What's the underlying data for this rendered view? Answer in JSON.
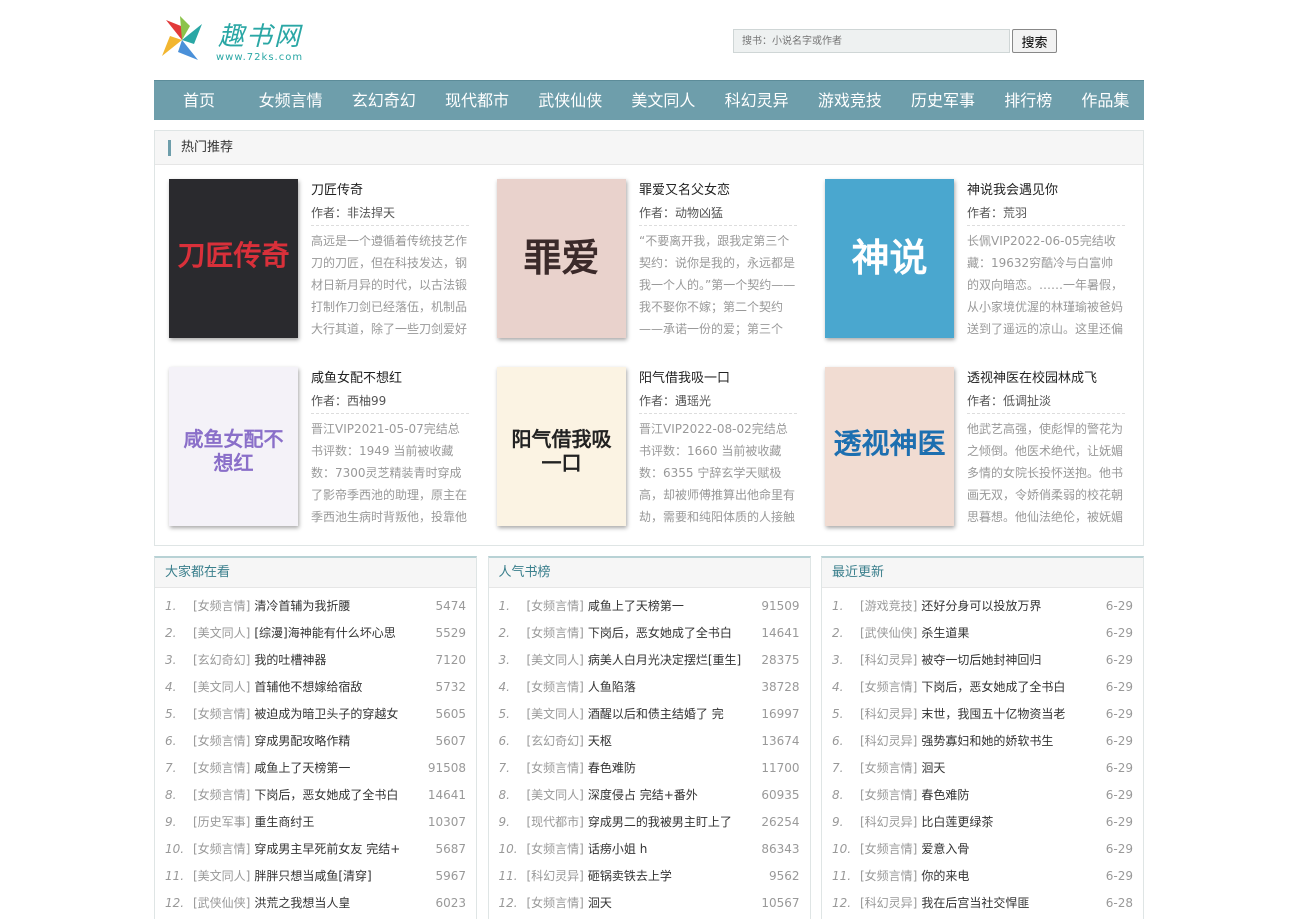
{
  "header": {
    "logo_text": "趣书网",
    "logo_url": "www.72ks.com",
    "search_placeholder": "搜书：小说名字或作者",
    "search_button": "搜索"
  },
  "nav": [
    "首页",
    "女频言情",
    "玄幻奇幻",
    "现代都市",
    "武侠仙侠",
    "美文同人",
    "科幻灵异",
    "游戏竞技",
    "历史军事",
    "排行榜",
    "作品集"
  ],
  "hot": {
    "title": "热门推荐",
    "books": [
      {
        "title": "刀匠传奇",
        "author": "作者：非法捍天",
        "desc": "高远是一个遵循着传统技艺作刀的刀匠，但在科技发达，钢材日新月异的时代，以古法锻打制作刀剑已经落伍，机制品大行其道，除了一些刀剑爱好",
        "cover_text": "刀匠传奇",
        "cover_bg": "#2a2a2e",
        "cover_fg": "#d9303a"
      },
      {
        "title": "罪爱又名父女恋",
        "author": "作者：动物凶猛",
        "desc": "“不要离开我，跟我定第三个契约：说你是我的，永远都是我一个人的。”第一个契约——我不娶你不嫁；第二个契约——承诺一份的爱；第三个",
        "cover_text": "罪爱",
        "cover_bg": "#e9d2cc",
        "cover_fg": "#3b2a2a"
      },
      {
        "title": "神说我会遇见你",
        "author": "作者：荒羽",
        "desc": "长佩VIP2022-06-05完结收藏：19632穷酷冷与白富帅的双向暗恋。……一年暑假，从小家境优渥的林瑾瑜被爸妈送到了遥远的凉山。这里还偏僻",
        "cover_text": "神说",
        "cover_bg": "#4aa7cf",
        "cover_fg": "#ffffff"
      },
      {
        "title": "咸鱼女配不想红",
        "author": "作者：西柚99",
        "desc": "晋江VIP2021-05-07完结总书评数：1949 当前被收藏数：7300灵芝精装青时穿成了影帝季西池的助理，原主在季西池生病时背叛他，投靠他",
        "cover_text": "咸鱼女配不想红",
        "cover_bg": "#f4f2f8",
        "cover_fg": "#8a6fc9"
      },
      {
        "title": "阳气借我吸一口",
        "author": "作者：遇瑶光",
        "desc": "晋江VIP2022-08-02完结总书评数：1660 当前被收藏数：6355 宁辞玄学天赋极高，却被师傅推算出他命里有劫，需要和纯阳体质的人接触",
        "cover_text": "阳气借我吸一口",
        "cover_bg": "#fbf3e3",
        "cover_fg": "#222222"
      },
      {
        "title": "透视神医在校园林成飞",
        "author": "作者：低调扯淡",
        "desc": "他武艺高强，使彪悍的警花为之倾倒。他医术绝代，让妩媚多情的女院长投怀送抱。他书画无双，令娇俏柔弱的校花朝思暮想。他仙法绝伦，被妩媚",
        "cover_text": "透视神医",
        "cover_bg": "#f1dcd2",
        "cover_fg": "#1d6fb0"
      }
    ]
  },
  "lists": [
    {
      "title": "大家都在看",
      "rows": [
        {
          "n": "1.",
          "cat": "[女频言情]",
          "title": "清冷首辅为我折腰",
          "val": "5474"
        },
        {
          "n": "2.",
          "cat": "[美文同人]",
          "title": "[综漫]海神能有什么坏心思",
          "val": "5529"
        },
        {
          "n": "3.",
          "cat": "[玄幻奇幻]",
          "title": "我的吐槽神器",
          "val": "7120"
        },
        {
          "n": "4.",
          "cat": "[美文同人]",
          "title": "首辅他不想嫁给宿敌",
          "val": "5732"
        },
        {
          "n": "5.",
          "cat": "[女频言情]",
          "title": "被迫成为暗卫头子的穿越女",
          "val": "5605"
        },
        {
          "n": "6.",
          "cat": "[女频言情]",
          "title": "穿成男配攻略作精",
          "val": "5607"
        },
        {
          "n": "7.",
          "cat": "[女频言情]",
          "title": "咸鱼上了天榜第一",
          "val": "91508"
        },
        {
          "n": "8.",
          "cat": "[女频言情]",
          "title": "下岗后，恶女她成了全书白",
          "val": "14641"
        },
        {
          "n": "9.",
          "cat": "[历史军事]",
          "title": "重生商纣王",
          "val": "10307"
        },
        {
          "n": "10.",
          "cat": "[女频言情]",
          "title": "穿成男主早死前女友 完结+",
          "val": "5687"
        },
        {
          "n": "11.",
          "cat": "[美文同人]",
          "title": "胖胖只想当咸鱼[清穿]",
          "val": "5967"
        },
        {
          "n": "12.",
          "cat": "[武侠仙侠]",
          "title": "洪荒之我想当人皇",
          "val": "6023"
        }
      ]
    },
    {
      "title": "人气书榜",
      "rows": [
        {
          "n": "1.",
          "cat": "[女频言情]",
          "title": "咸鱼上了天榜第一",
          "val": "91509"
        },
        {
          "n": "2.",
          "cat": "[女频言情]",
          "title": "下岗后，恶女她成了全书白",
          "val": "14641"
        },
        {
          "n": "3.",
          "cat": "[美文同人]",
          "title": "病美人白月光决定摆烂[重生]",
          "val": "28375"
        },
        {
          "n": "4.",
          "cat": "[女频言情]",
          "title": "人鱼陷落",
          "val": "38728"
        },
        {
          "n": "5.",
          "cat": "[美文同人]",
          "title": "酒醒以后和债主结婚了 完",
          "val": "16997"
        },
        {
          "n": "6.",
          "cat": "[玄幻奇幻]",
          "title": "天枢",
          "val": "13674"
        },
        {
          "n": "7.",
          "cat": "[女频言情]",
          "title": "春色难防",
          "val": "11700"
        },
        {
          "n": "8.",
          "cat": "[美文同人]",
          "title": "深度侵占 完结+番外",
          "val": "60935"
        },
        {
          "n": "9.",
          "cat": "[现代都市]",
          "title": "穿成男二的我被男主盯上了",
          "val": "26254"
        },
        {
          "n": "10.",
          "cat": "[女频言情]",
          "title": "话痨小姐 h",
          "val": "86343"
        },
        {
          "n": "11.",
          "cat": "[科幻灵异]",
          "title": "砸锅卖铁去上学",
          "val": "9562"
        },
        {
          "n": "12.",
          "cat": "[女频言情]",
          "title": "洄天",
          "val": "10567"
        }
      ]
    },
    {
      "title": "最近更新",
      "rows": [
        {
          "n": "1.",
          "cat": "[游戏竞技]",
          "title": "还好分身可以投放万界",
          "val": "6-29"
        },
        {
          "n": "2.",
          "cat": "[武侠仙侠]",
          "title": "杀生道果",
          "val": "6-29"
        },
        {
          "n": "3.",
          "cat": "[科幻灵异]",
          "title": "被夺一切后她封神回归",
          "val": "6-29"
        },
        {
          "n": "4.",
          "cat": "[女频言情]",
          "title": "下岗后，恶女她成了全书白",
          "val": "6-29"
        },
        {
          "n": "5.",
          "cat": "[科幻灵异]",
          "title": "末世，我囤五十亿物资当老",
          "val": "6-29"
        },
        {
          "n": "6.",
          "cat": "[科幻灵异]",
          "title": "强势寡妇和她的娇软书生",
          "val": "6-29"
        },
        {
          "n": "7.",
          "cat": "[女频言情]",
          "title": "洄天",
          "val": "6-29"
        },
        {
          "n": "8.",
          "cat": "[女频言情]",
          "title": "春色难防",
          "val": "6-29"
        },
        {
          "n": "9.",
          "cat": "[科幻灵异]",
          "title": "比白莲更绿茶",
          "val": "6-29"
        },
        {
          "n": "10.",
          "cat": "[女频言情]",
          "title": "爱意入骨",
          "val": "6-29"
        },
        {
          "n": "11.",
          "cat": "[女频言情]",
          "title": "你的来电",
          "val": "6-29"
        },
        {
          "n": "12.",
          "cat": "[科幻灵异]",
          "title": "我在后宫当社交悍匪",
          "val": "6-28"
        }
      ]
    }
  ]
}
